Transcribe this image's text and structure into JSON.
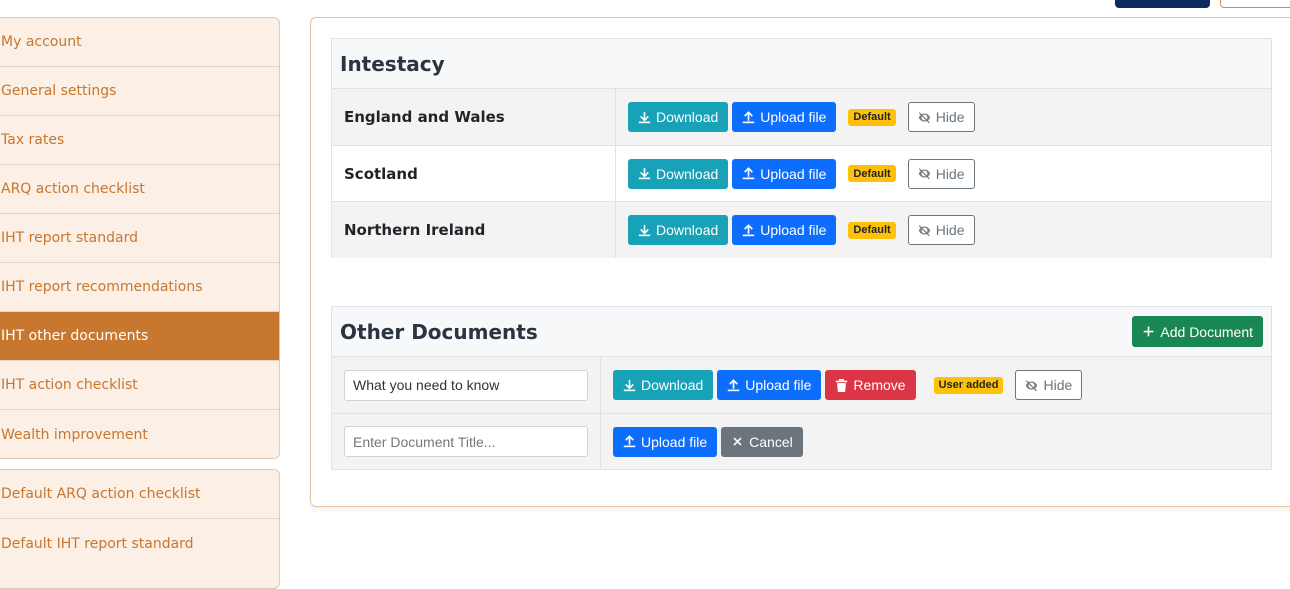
{
  "sidebar": {
    "group1": [
      {
        "label": "My account"
      },
      {
        "label": "General settings"
      },
      {
        "label": "Tax rates"
      },
      {
        "label": "ARQ action checklist"
      },
      {
        "label": "IHT report standard"
      },
      {
        "label": "IHT report recommendations"
      },
      {
        "label": "IHT other documents",
        "active": true
      },
      {
        "label": "IHT action checklist"
      },
      {
        "label": "Wealth improvement"
      }
    ],
    "group2": [
      {
        "label": "Default ARQ action checklist"
      },
      {
        "label": "Default IHT report standard"
      }
    ]
  },
  "intestacy": {
    "title": "Intestacy",
    "rows": [
      {
        "name": "England and Wales",
        "download": "Download",
        "upload": "Upload file",
        "badge": "Default",
        "hide": "Hide"
      },
      {
        "name": "Scotland",
        "download": "Download",
        "upload": "Upload file",
        "badge": "Default",
        "hide": "Hide"
      },
      {
        "name": "Northern Ireland",
        "download": "Download",
        "upload": "Upload file",
        "badge": "Default",
        "hide": "Hide"
      }
    ]
  },
  "other_documents": {
    "title": "Other Documents",
    "add_button": "Add Document",
    "rows": [
      {
        "title_value": "What you need to know",
        "download": "Download",
        "upload": "Upload file",
        "remove": "Remove",
        "badge": "User added",
        "hide": "Hide"
      }
    ],
    "new_row": {
      "placeholder": "Enter Document Title...",
      "upload": "Upload file",
      "cancel": "Cancel"
    }
  },
  "colors": {
    "accent": "#c8772f",
    "download": "#17a2b8",
    "upload": "#0d6efd",
    "remove": "#dc3545",
    "add": "#198754",
    "badge": "#ffc107"
  },
  "icons": {
    "download": "download-icon",
    "upload": "upload-icon",
    "hide": "eye-slash-icon",
    "remove": "trash-icon",
    "add": "plus-icon",
    "cancel": "close-icon"
  }
}
